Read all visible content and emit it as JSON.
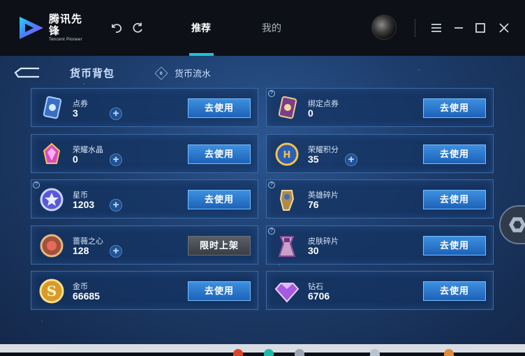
{
  "app": {
    "logo_cn": "腾讯先锋",
    "logo_en": "Tencent Pioneer"
  },
  "tabs": [
    {
      "label": "推荐",
      "active": true
    },
    {
      "label": "我的",
      "active": false
    }
  ],
  "page": {
    "title": "货币背包",
    "flow_label": "货币流水",
    "flow_icon_glyph": "0"
  },
  "cards": [
    {
      "name": "点券",
      "amount": "3",
      "plus": true,
      "help": false,
      "button": "去使用",
      "icon": "coupon-icon"
    },
    {
      "name": "绑定点券",
      "amount": "0",
      "plus": false,
      "help": true,
      "button": "去使用",
      "icon": "bound-coupon-icon"
    },
    {
      "name": "荣耀水晶",
      "amount": "0",
      "plus": true,
      "help": false,
      "button": "去使用",
      "icon": "glory-crystal-icon"
    },
    {
      "name": "荣耀积分",
      "amount": "35",
      "plus": true,
      "help": false,
      "button": "去使用",
      "icon": "glory-points-icon"
    },
    {
      "name": "星币",
      "amount": "1203",
      "plus": true,
      "help": true,
      "button": "去使用",
      "icon": "star-coin-icon"
    },
    {
      "name": "英雄碎片",
      "amount": "76",
      "plus": false,
      "help": true,
      "button": "去使用",
      "icon": "hero-fragment-icon"
    },
    {
      "name": "蔷薇之心",
      "amount": "128",
      "plus": true,
      "help": false,
      "button": "限时上架",
      "icon": "rose-heart-icon",
      "button_disabled": true
    },
    {
      "name": "皮肤碎片",
      "amount": "30",
      "plus": false,
      "help": true,
      "button": "去使用",
      "icon": "skin-fragment-icon"
    },
    {
      "name": "金币",
      "amount": "66685",
      "plus": false,
      "help": false,
      "button": "去使用",
      "icon": "gold-coin-icon"
    },
    {
      "name": "钻石",
      "amount": "6706",
      "plus": false,
      "help": false,
      "button": "去使用",
      "icon": "diamond-icon"
    }
  ],
  "colors": {
    "accent": "#1fc4d4",
    "button": "#2a78d0",
    "card_border": "#3c6aa4"
  }
}
